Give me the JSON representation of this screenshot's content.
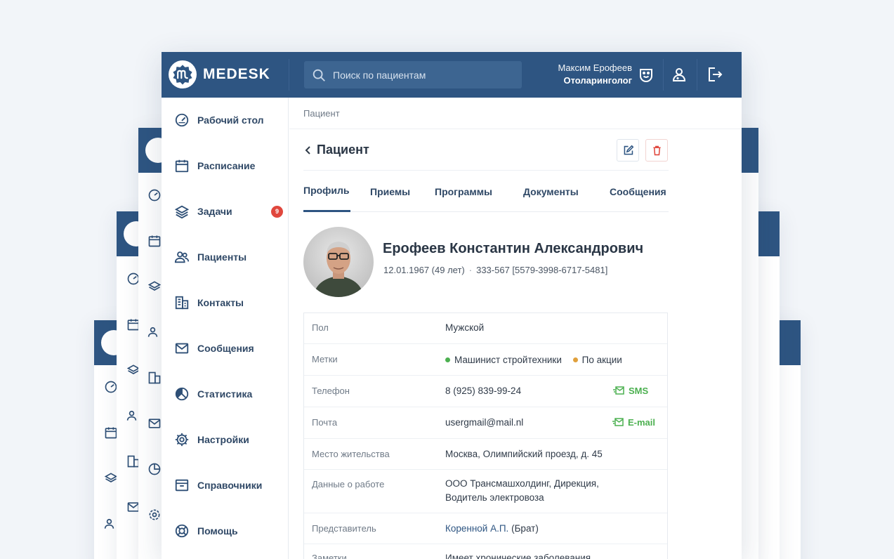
{
  "colors": {
    "brand": "#2e5582",
    "badge": "#e0473d",
    "success": "#4cb050",
    "tag_green": "#4cb050",
    "tag_orange": "#e0a03c"
  },
  "header": {
    "brand": "MEDESK",
    "search_placeholder": "Поиск по пациентам",
    "user_name": "Максим Ерофеев",
    "user_role": "Отоларинголог"
  },
  "sidebar": {
    "items": [
      {
        "label": "Рабочий стол",
        "icon": "dashboard-gauge-icon"
      },
      {
        "label": "Расписание",
        "icon": "calendar-icon"
      },
      {
        "label": "Задачи",
        "icon": "layers-icon",
        "badge": "9"
      },
      {
        "label": "Пациенты",
        "icon": "users-icon"
      },
      {
        "label": "Контакты",
        "icon": "buildings-icon"
      },
      {
        "label": "Сообщения",
        "icon": "envelope-icon"
      },
      {
        "label": "Статистика",
        "icon": "pie-chart-icon"
      },
      {
        "label": "Настройки",
        "icon": "gear-icon"
      },
      {
        "label": "Справочники",
        "icon": "archive-box-icon"
      },
      {
        "label": "Помощь",
        "icon": "lifebuoy-icon"
      }
    ]
  },
  "breadcrumb": "Пациент",
  "page_title": "Пациент",
  "tabs": [
    {
      "label": "Профиль",
      "active": true
    },
    {
      "label": "Приемы"
    },
    {
      "label": "Программы"
    },
    {
      "label": "Документы"
    },
    {
      "label": "Сообщения"
    }
  ],
  "patient": {
    "name": "Ерофеев Константин Александрович",
    "birth": "12.01.1967 (49 лет)",
    "separator": "·",
    "id": "333-567 [5579-3998-6717-5481]"
  },
  "info": {
    "gender": {
      "label": "Пол",
      "value": "Мужской"
    },
    "tags": {
      "label": "Метки",
      "items": [
        "Машинист стройтехники",
        "По акции"
      ]
    },
    "phone": {
      "label": "Телефон",
      "value": "8 (925) 839-99-24",
      "action": "SMS"
    },
    "email": {
      "label": "Почта",
      "value": "usergmail@mail.nl",
      "action": "E-mail"
    },
    "address": {
      "label": "Место жительства",
      "value": "Москва, Олимпийский проезд, д. 45"
    },
    "work": {
      "label": "Данные о работе",
      "line1": "ООО Трансмашхолдинг, Дирекция,",
      "line2": "Водитель электровоза"
    },
    "representative": {
      "label": "Представитель",
      "link": "Коренной А.П.",
      "relation": "(Брат)"
    },
    "notes": {
      "label": "Заметки",
      "value": "Имеет хронические заболевания"
    }
  }
}
